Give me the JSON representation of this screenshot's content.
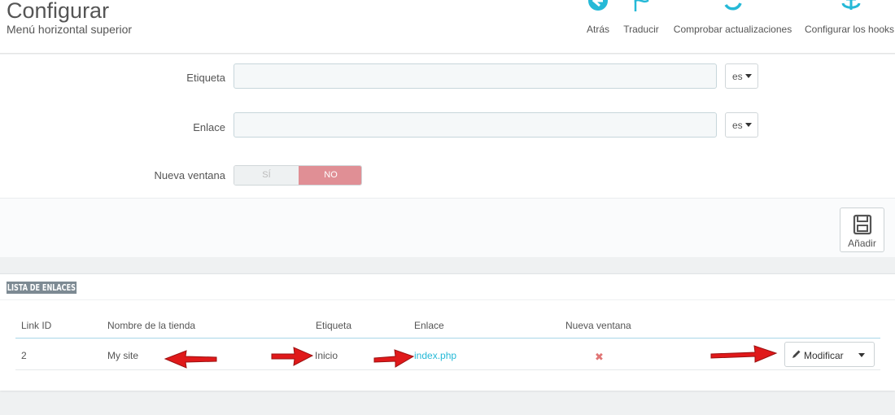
{
  "header": {
    "title": "Configurar",
    "subtitle": "Menú horizontal superior"
  },
  "toolbar": {
    "items": [
      {
        "label": "Atrás",
        "icon": "back-arrow-circle-icon"
      },
      {
        "label": "Traducir",
        "icon": "flag-icon"
      },
      {
        "label": "Comprobar actualizaciones",
        "icon": "refresh-icon"
      },
      {
        "label": "Configurar los hooks",
        "icon": "anchor-icon"
      }
    ]
  },
  "form": {
    "label_field": {
      "label": "Etiqueta",
      "value": "",
      "lang": "es"
    },
    "link_field": {
      "label": "Enlace",
      "value": "",
      "lang": "es"
    },
    "new_window": {
      "label": "Nueva ventana",
      "yes": "SÍ",
      "no": "NO",
      "selected": "NO"
    },
    "add_button": "Añadir"
  },
  "links_list": {
    "heading": "LISTA DE ENLACES",
    "columns": [
      "Link ID",
      "Nombre de la tienda",
      "Etiqueta",
      "Enlace",
      "Nueva ventana"
    ],
    "rows": [
      {
        "link_id": "2",
        "shop_name": "My site",
        "label": "Inicio",
        "link": "index.php",
        "new_window": "✖"
      }
    ],
    "row_action": "Modificar"
  },
  "colors": {
    "accent": "#25b9d7",
    "switch_no": "#e08f95",
    "annotation_arrow": "#e0191a"
  }
}
